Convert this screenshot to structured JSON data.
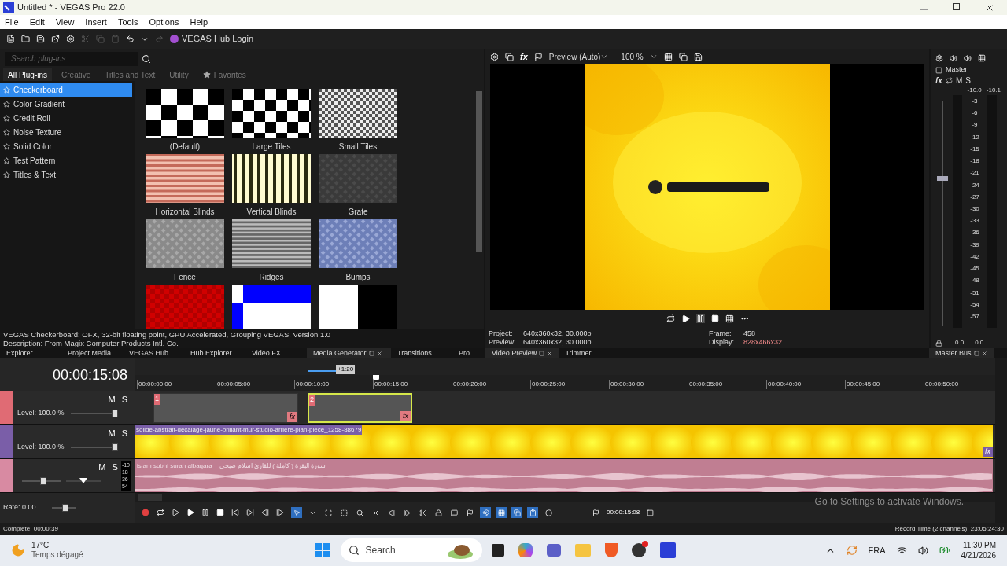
{
  "window": {
    "title": "Untitled * - VEGAS Pro 22.0"
  },
  "menu": [
    "File",
    "Edit",
    "View",
    "Insert",
    "Tools",
    "Options",
    "Help"
  ],
  "toolbar": {
    "hub_login": "VEGAS Hub Login"
  },
  "plugins": {
    "search": {
      "placeholder": "Search plug-ins"
    },
    "tabs": [
      {
        "label": "All Plug-ins",
        "selected": true,
        "kind": "text"
      },
      {
        "label": "Creative",
        "selected": false,
        "kind": "text"
      },
      {
        "label": "Titles and Text",
        "selected": false,
        "kind": "text"
      },
      {
        "label": "Utility",
        "selected": false,
        "kind": "text"
      },
      {
        "label": "Favorites",
        "selected": false,
        "kind": "favorites"
      }
    ],
    "list": [
      {
        "label": "Checkerboard",
        "selected": true
      },
      {
        "label": "Color Gradient",
        "selected": false
      },
      {
        "label": "Credit Roll",
        "selected": false
      },
      {
        "label": "Noise Texture",
        "selected": false
      },
      {
        "label": "Solid Color",
        "selected": false
      },
      {
        "label": "Test Pattern",
        "selected": false
      },
      {
        "label": "Titles & Text",
        "selected": false
      }
    ],
    "presets": [
      {
        "label": "(Default)",
        "kind": "checker-large"
      },
      {
        "label": "Large Tiles",
        "kind": "checker-medium"
      },
      {
        "label": "Small Tiles",
        "kind": "checker-small"
      },
      {
        "label": "Horizontal Blinds",
        "kind": "horizontal-blinds"
      },
      {
        "label": "Vertical Blinds",
        "kind": "vertical-blinds"
      },
      {
        "label": "Grate",
        "kind": "grate"
      },
      {
        "label": "Fence",
        "kind": "fence"
      },
      {
        "label": "Ridges",
        "kind": "ridges"
      },
      {
        "label": "Bumps",
        "kind": "bumps"
      },
      {
        "kind": "red-checker"
      },
      {
        "kind": "blue-split"
      },
      {
        "kind": "black-split"
      }
    ],
    "info": [
      "VEGAS Checkerboard: OFX, 32-bit floating point, GPU Accelerated, Grouping VEGAS, Version 1.0",
      "Description: From Magix Computer Products Intl. Co."
    ]
  },
  "preview": {
    "fx": "fx",
    "mode": "Preview (Auto)",
    "zoom": "100 %",
    "stats": [
      {
        "label": "Project:",
        "value": "640x360x32, 30.000p",
        "kind": "plain"
      },
      {
        "label": "Preview:",
        "value": "640x360x32, 30.000p",
        "kind": "plain"
      },
      {
        "label": "Frame:",
        "value": "458",
        "kind": "plain"
      },
      {
        "label": "Display:",
        "value": "828x466x32",
        "kind": "warning"
      }
    ]
  },
  "master": {
    "label": "Master",
    "fx": "fx",
    "mute": "M",
    "solo": "S",
    "peaks": [
      "-10.0",
      "-10.1"
    ],
    "scale": [
      "-3",
      "-6",
      "-9",
      "-12",
      "-15",
      "-18",
      "-21",
      "-24",
      "-27",
      "-30",
      "-33",
      "-36",
      "-39",
      "-42",
      "-45",
      "-48",
      "-51",
      "-54",
      "-57"
    ],
    "readings": [
      "0.0",
      "0.0"
    ],
    "fader": {
      "level": 0.66
    }
  },
  "dock_tabs": [
    {
      "label": "Explorer",
      "selected": false
    },
    {
      "label": "Project Media",
      "selected": false
    },
    {
      "label": "VEGAS Hub",
      "selected": false
    },
    {
      "label": "Hub Explorer",
      "selected": false
    },
    {
      "label": "Video FX",
      "selected": false
    },
    {
      "label": "Media Generator",
      "selected": true
    },
    {
      "label": "Transitions",
      "selected": false
    },
    {
      "label": "Pro",
      "selected": false
    }
  ],
  "preview_tabs": [
    {
      "label": "Video Preview",
      "selected": true
    },
    {
      "label": "Trimmer",
      "selected": false
    }
  ],
  "master_tab": "Master Bus",
  "timeline": {
    "timecode": "00:00:15:08",
    "zoom_badge": "+1:20",
    "ruler": [
      "00:00:00:00",
      "00:00:05:00",
      "00:00:10:00",
      "00:00:15:00",
      "00:00:20:00",
      "00:00:25:00",
      "00:00:30:00",
      "00:00:35:00",
      "00:00:40:00",
      "00:00:45:00",
      "00:00:50:00"
    ],
    "tracks": [
      {
        "kind": "video",
        "color": "#e06b74",
        "mute": "M",
        "solo": "S",
        "level_text": "Level: 100.0 %",
        "level": 1.0,
        "events": [
          {
            "number": "1",
            "fx": "fx",
            "selected": false
          },
          {
            "number": "2",
            "fx": "fx",
            "selected": true
          }
        ]
      },
      {
        "kind": "video",
        "color": "#7a5ea8",
        "mute": "M",
        "solo": "S",
        "level_text": "Level: 100.0 %",
        "level": 1.0,
        "events": [
          {
            "name": "solide-abstrait-decalage-jaune-brillant-mur-studio-arriere-plan-piece_1258-88679",
            "fx": "fx",
            "selected": false
          }
        ]
      },
      {
        "kind": "audio",
        "color": "#d88aa2",
        "mute": "M",
        "solo": "S",
        "level": 0.55,
        "pan": {
          "level": 0.5
        },
        "meter": [
          "-10",
          "18",
          "36",
          "54"
        ],
        "events": [
          {
            "name": "سورة البقرة ( كاملة ) للقارئ اسلام صبحي _ islam sobhi surah albaqara",
            "selected": false
          }
        ]
      }
    ],
    "rate": {
      "text": "Rate: 0.00",
      "level": 0.6
    },
    "tools": [
      {
        "kind": "select",
        "on": true
      },
      {
        "kind": "dropdown",
        "on": false
      },
      {
        "kind": "envelope",
        "on": false
      },
      {
        "kind": "selection",
        "on": false
      },
      {
        "kind": "zoom",
        "on": false
      },
      {
        "kind": "delete",
        "on": false
      },
      {
        "kind": "trim-start",
        "on": false
      },
      {
        "kind": "trim-end",
        "on": false
      },
      {
        "kind": "split",
        "on": false
      },
      {
        "kind": "lock",
        "on": false
      },
      {
        "kind": "marker",
        "on": false
      },
      {
        "kind": "region",
        "on": false
      },
      {
        "kind": "snap",
        "on": true
      },
      {
        "kind": "auto-ripple",
        "on": true
      },
      {
        "kind": "lock-envelopes",
        "on": true
      },
      {
        "kind": "group",
        "on": true
      },
      {
        "kind": "color",
        "on": false
      }
    ],
    "cursor_time": "00:00:15:08",
    "activation": "Go to Settings to activate Windows."
  },
  "status": {
    "left": "Complete: 00:00:39",
    "right": "Record Time (2 channels): 23:05:24:30"
  },
  "taskbar": {
    "temperature": "17°C",
    "condition": "Temps dégagé",
    "search": "Search",
    "language": "FRA",
    "time": "11:30 PM",
    "date": "4/21/2026"
  }
}
